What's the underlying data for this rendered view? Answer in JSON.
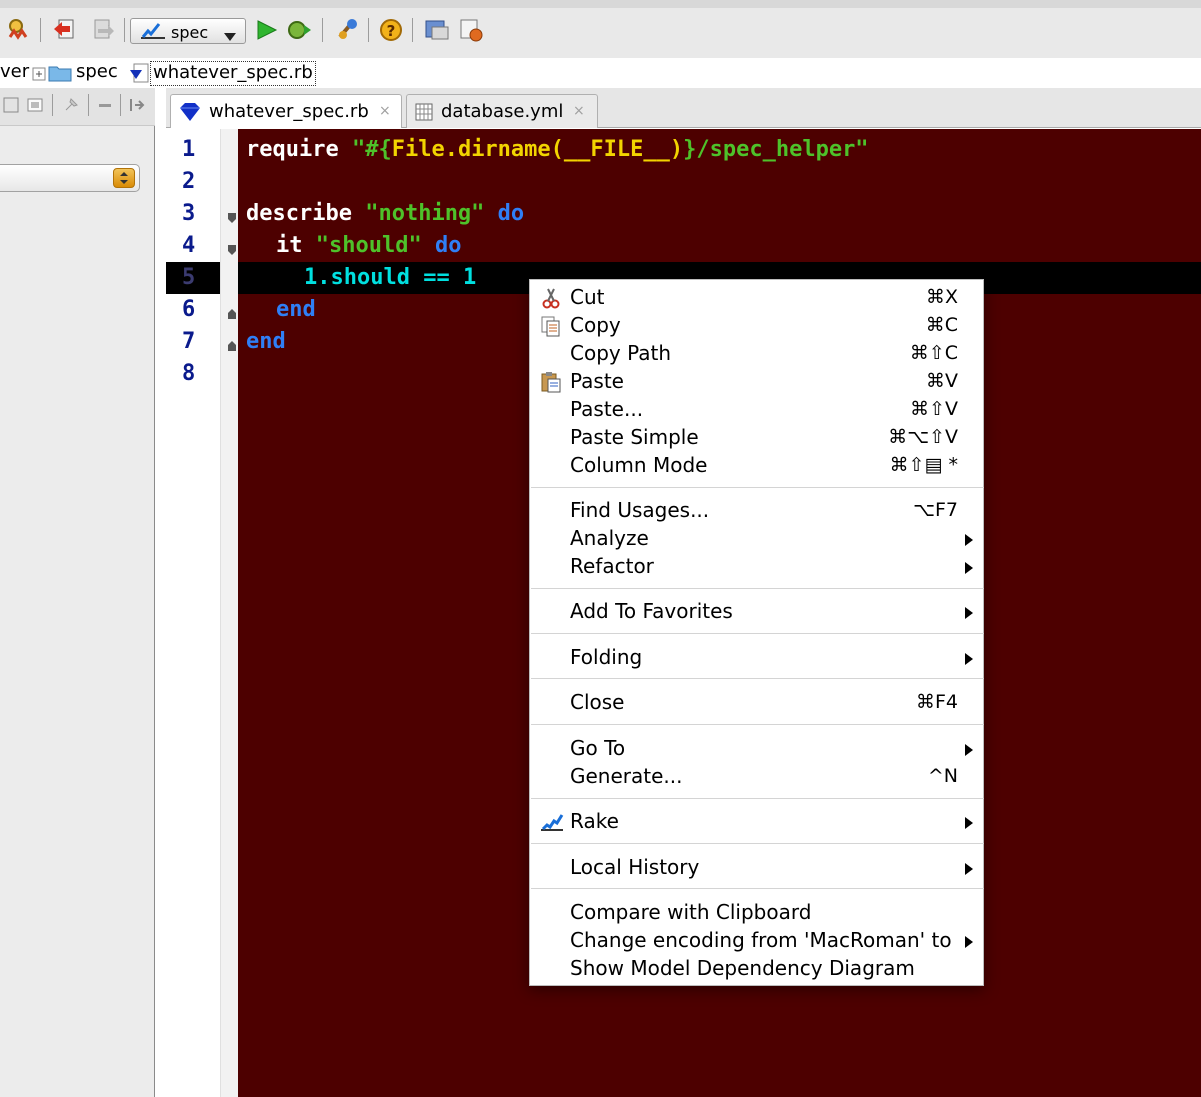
{
  "toolbar": {
    "run_config": "spec",
    "icons": [
      "find-icon",
      "back-icon",
      "forward-icon",
      "run-config-icon",
      "run-icon",
      "debug-icon",
      "build-icon",
      "help-icon",
      "deploy-icon",
      "settings-icon"
    ]
  },
  "breadcrumb": {
    "project_partial": "ver",
    "folder": "spec",
    "file": "whatever_spec.rb"
  },
  "tabs": [
    {
      "label": "whatever_spec.rb",
      "close": "×",
      "active": true,
      "icon": "ruby-gem-icon"
    },
    {
      "label": "database.yml",
      "close": "×",
      "active": false,
      "icon": "yml-file-icon"
    }
  ],
  "editor": {
    "line_numbers": [
      "1",
      "2",
      "3",
      "4",
      "5",
      "6",
      "7",
      "8"
    ],
    "current_line": "5",
    "colors": {
      "background": "#4d0000",
      "current_line": "#000000"
    },
    "lines": {
      "l1": {
        "kw": "require ",
        "str1": "\"#{",
        "interp": "File.dirname(__FILE__)",
        "str2": "}/spec_helper\""
      },
      "l3": {
        "kw": "describe ",
        "str": "\"nothing\"",
        "do": " do"
      },
      "l4": {
        "kw": "it ",
        "str": "\"should\"",
        "do": " do"
      },
      "l5": {
        "code": "1.should == 1"
      },
      "l6": {
        "kw": "end"
      },
      "l7": {
        "kw": "end"
      }
    }
  },
  "context_menu": {
    "items": [
      {
        "label": "Cut",
        "shortcut": "⌘X",
        "icon": "scissors-icon"
      },
      {
        "label": "Copy",
        "shortcut": "⌘C",
        "icon": "copy-icon"
      },
      {
        "label": "Copy Path",
        "shortcut": "⌘⇧C"
      },
      {
        "label": "Paste",
        "shortcut": "⌘V",
        "icon": "paste-icon"
      },
      {
        "label": "Paste...",
        "shortcut": "⌘⇧V"
      },
      {
        "label": "Paste Simple",
        "shortcut": "⌘⌥⇧V"
      },
      {
        "label": "Column Mode",
        "shortcut": "⌘⇧▤ *"
      },
      {
        "label": "Find Usages...",
        "shortcut": "⌥F7"
      },
      {
        "label": "Analyze",
        "submenu": true
      },
      {
        "label": "Refactor",
        "submenu": true
      },
      {
        "label": "Add To Favorites",
        "submenu": true
      },
      {
        "label": "Folding",
        "submenu": true
      },
      {
        "label": "Close",
        "shortcut": "⌘F4"
      },
      {
        "label": "Go To",
        "submenu": true
      },
      {
        "label": "Generate...",
        "shortcut": "^N"
      },
      {
        "label": "Rake",
        "submenu": true,
        "icon": "rake-icon"
      },
      {
        "label": "Local History",
        "submenu": true
      },
      {
        "label": "Compare with Clipboard"
      },
      {
        "label": "Change encoding from 'MacRoman' to",
        "submenu": true
      },
      {
        "label": "Show Model Dependency Diagram"
      }
    ]
  }
}
